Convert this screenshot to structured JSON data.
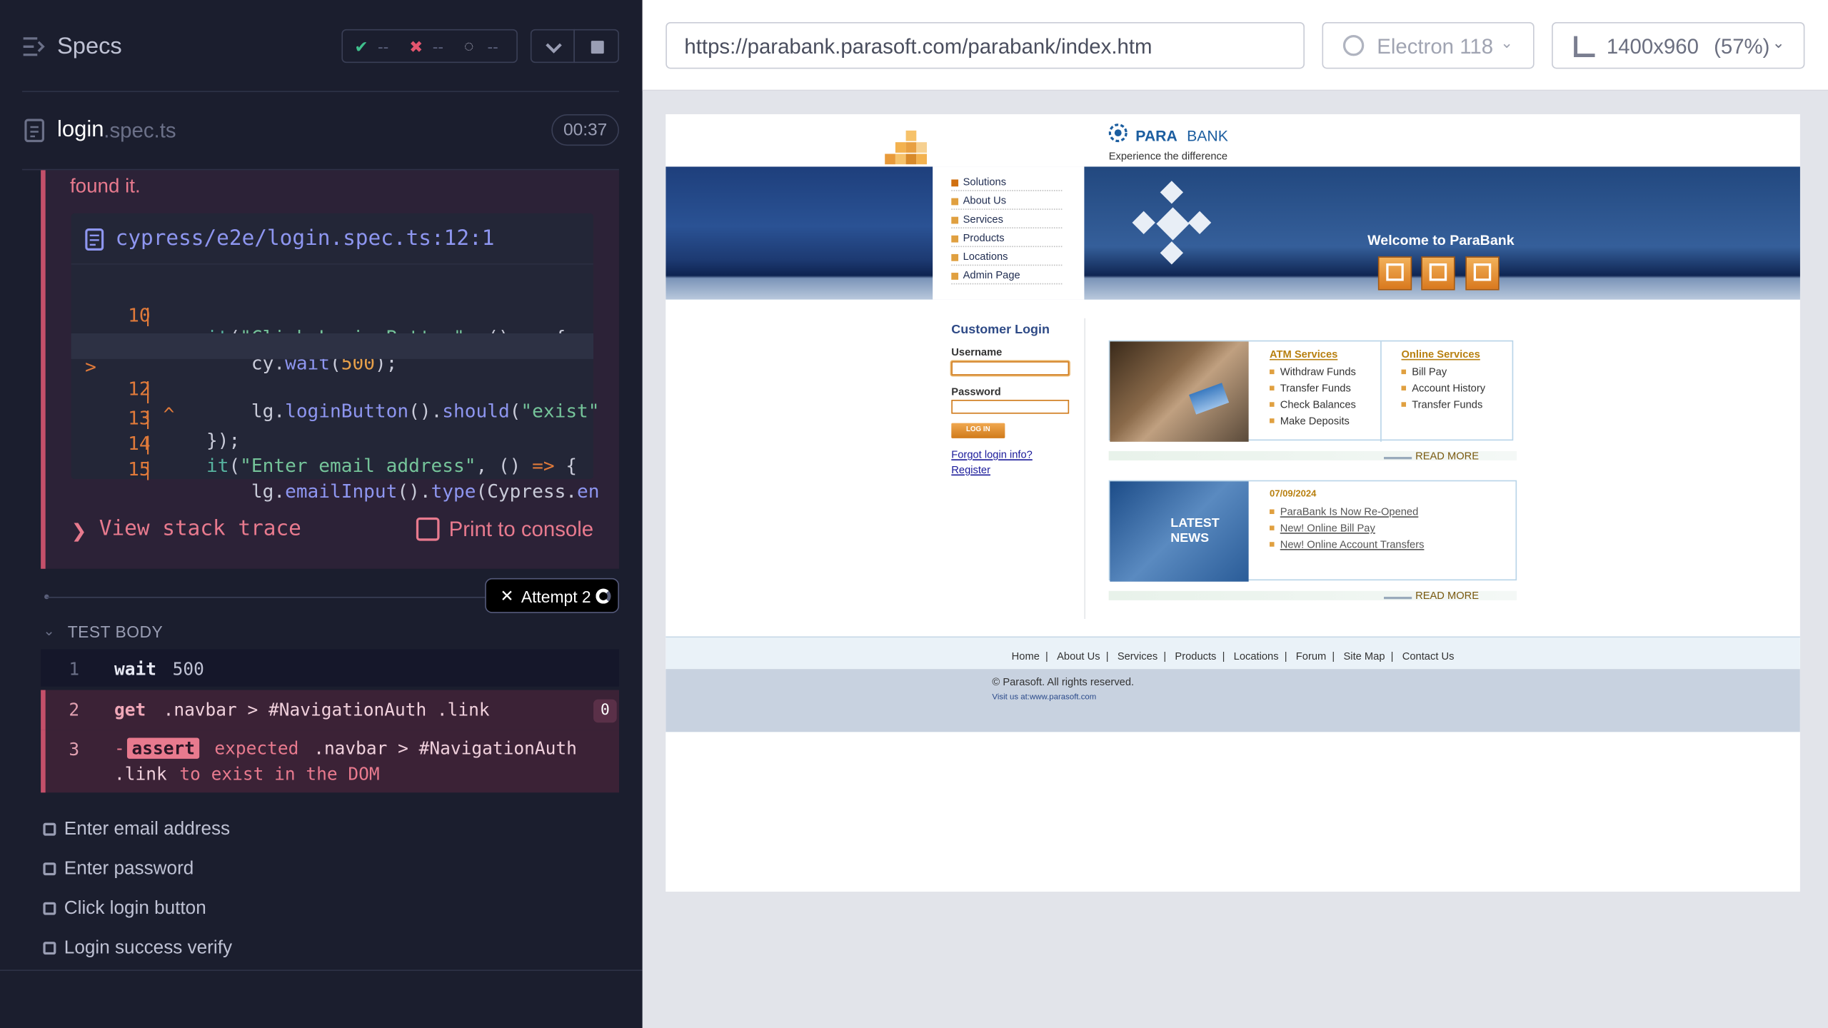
{
  "reporter": {
    "specs_title": "Specs",
    "stats": {
      "passed": "--",
      "failed": "--",
      "pending": "--"
    },
    "spec_file": {
      "name": "login",
      "ext": ".spec.ts",
      "duration": "00:37"
    },
    "error": {
      "message_tail": "found it.",
      "frame_path": "cypress/e2e/login.spec.ts:12:1",
      "code_lines": [
        {
          "num": "10",
          "marker": "",
          "code": "it(\"Click Login Button\", () => {"
        },
        {
          "num": "11",
          "marker": "",
          "code": "    cy.wait(500);"
        },
        {
          "num": "12",
          "marker": ">",
          "code": "    lg.loginButton().should(\"exist\""
        },
        {
          "num": "",
          "marker": "",
          "code": "^"
        },
        {
          "num": "13",
          "marker": "",
          "code": "});"
        },
        {
          "num": "14",
          "marker": "",
          "code": "it(\"Enter email address\", () => {"
        },
        {
          "num": "15",
          "marker": "",
          "code": "    lg.emailInput().type(Cypress.en"
        }
      ],
      "view_stack_trace": "View stack trace",
      "print_to_console": "Print to console"
    },
    "attempt_label": "Attempt 2",
    "test_body_label": "TEST BODY",
    "commands": [
      {
        "num": "1",
        "name": "wait",
        "arg": "500"
      },
      {
        "num": "2",
        "name": "get",
        "arg": ".navbar > #NavigationAuth .link",
        "badge": "0"
      },
      {
        "num": "3",
        "dash": "-",
        "name": "assert",
        "expected": "expected",
        "selector": ".navbar > #NavigationAuth",
        "link": ".link",
        "rest": "to exist in the DOM"
      }
    ],
    "tests": [
      {
        "label": "Enter email address"
      },
      {
        "label": "Enter password"
      },
      {
        "label": "Click login button"
      },
      {
        "label": "Login success verify"
      }
    ]
  },
  "aut": {
    "url": "https://parabank.parasoft.com/parabank/index.htm",
    "browser": "Electron 118",
    "viewport": "1400x960",
    "zoom": "(57%)",
    "site": {
      "brand_bold": "PARA",
      "brand_rest": "BANK",
      "tagline": "Experience the difference",
      "nav": [
        "Solutions",
        "About Us",
        "Services",
        "Products",
        "Locations",
        "Admin Page"
      ],
      "welcome": "Welcome to ParaBank",
      "login_title": "Customer Login",
      "username_label": "Username",
      "password_label": "Password",
      "login_button": "LOG IN",
      "forgot": "Forgot login info?",
      "register": "Register",
      "atm_services": {
        "title": "ATM Services",
        "items": [
          "Withdraw Funds",
          "Transfer Funds",
          "Check Balances",
          "Make Deposits"
        ]
      },
      "online_services": {
        "title": "Online Services",
        "items": [
          "Bill Pay",
          "Account History",
          "Transfer Funds"
        ]
      },
      "read_more": "READ MORE",
      "latest_news": "LATEST NEWS",
      "news_date": "07/09/2024",
      "news_items": [
        "ParaBank Is Now Re-Opened",
        "New! Online Bill Pay",
        "New! Online Account Transfers"
      ],
      "footer_links": [
        "Home",
        "About Us",
        "Services",
        "Products",
        "Locations",
        "Forum",
        "Site Map",
        "Contact Us"
      ],
      "copyright": "© Parasoft. All rights reserved.",
      "visit": "Visit us at:www.parasoft.com"
    }
  },
  "colors": {
    "reporter_bg": "#1b1e2e",
    "error_accent": "#e87a8e",
    "accent_orange": "#e07a3a",
    "link_blue": "#1a1a9a",
    "brand_blue": "#1c5ea0"
  }
}
